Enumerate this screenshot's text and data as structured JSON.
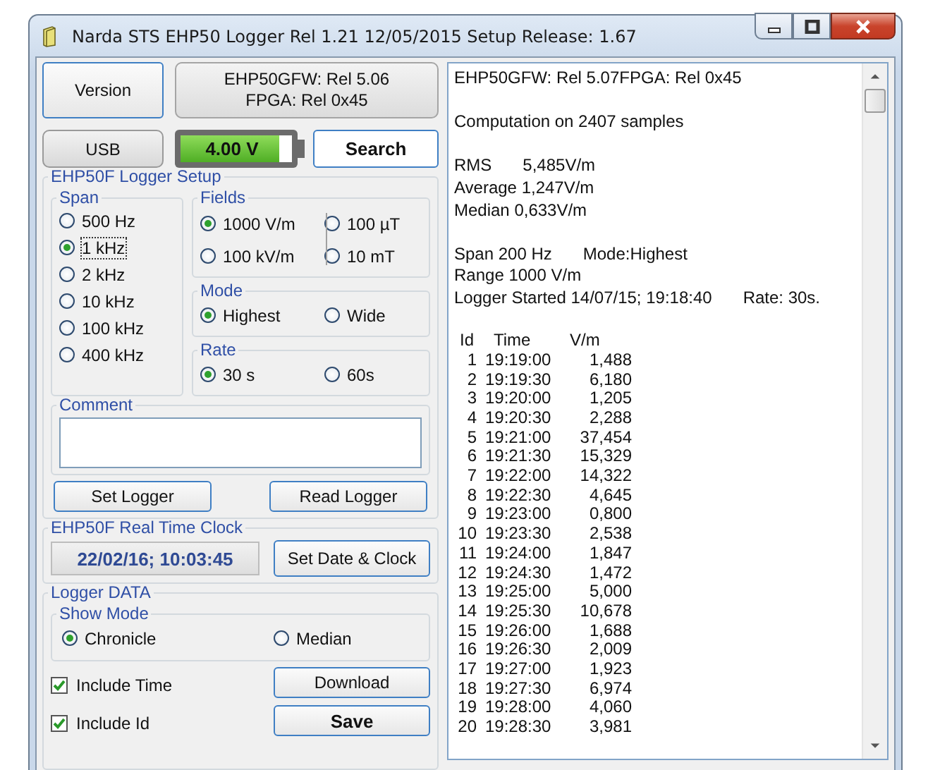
{
  "window": {
    "title": "Narda STS EHP50  Logger Rel 1.21 12/05/2015   Setup Release: 1.67"
  },
  "top": {
    "version_button": "Version",
    "firmware": [
      "EHP50GFW: Rel 5.06",
      "FPGA: Rel 0x45"
    ],
    "usb": "USB",
    "battery": {
      "reading": "4.00 V",
      "level": 0.88
    },
    "search_button": "Search"
  },
  "logger_setup": {
    "title": "EHP50F Logger Setup",
    "span": {
      "title": "Span",
      "options": [
        {
          "label": "500 Hz",
          "selected": false,
          "focused": false
        },
        {
          "label": "1 kHz",
          "selected": true,
          "focused": true
        },
        {
          "label": "2 kHz",
          "selected": false,
          "focused": false
        },
        {
          "label": "10  kHz",
          "selected": false,
          "focused": false
        },
        {
          "label": "100 kHz",
          "selected": false,
          "focused": false
        },
        {
          "label": "400 kHz",
          "selected": false,
          "focused": false
        }
      ]
    },
    "fields": {
      "title": "Fields",
      "options": [
        {
          "label": "1000 V/m",
          "selected": true
        },
        {
          "label": "100 µT",
          "selected": false
        },
        {
          "label": "100 kV/m",
          "selected": false
        },
        {
          "label": "10 mT",
          "selected": false
        }
      ]
    },
    "mode": {
      "title": "Mode",
      "options": [
        {
          "label": "Highest",
          "selected": true
        },
        {
          "label": "Wide",
          "selected": false
        }
      ]
    },
    "rate": {
      "title": "Rate",
      "options": [
        {
          "label": "30 s",
          "selected": true
        },
        {
          "label": "60s",
          "selected": false
        }
      ]
    },
    "comment": {
      "title": "Comment"
    },
    "set_button": "Set Logger",
    "read_button": "Read Logger"
  },
  "clock": {
    "title": "EHP50F Real Time Clock",
    "value": "22/02/16; 10:03:45",
    "button": "Set Date & Clock"
  },
  "logger_data": {
    "title": "Logger DATA",
    "show_mode": {
      "title": "Show Mode",
      "options": [
        {
          "label": "Chronicle",
          "selected": true
        },
        {
          "label": "Median",
          "selected": false
        }
      ]
    },
    "checkboxes": [
      {
        "label": "Include Time",
        "checked": true
      },
      {
        "label": "Include Id",
        "checked": true
      }
    ],
    "download_button": "Download",
    "save_button": "Save"
  },
  "output": {
    "blocks": [
      [
        [
          "EHP50GFW: Rel 5.07FPGA: Rel 0x45"
        ]
      ],
      [
        [
          "Computation on 2407 samples"
        ]
      ],
      [
        [
          "RMS",
          "5,485V/m"
        ],
        [
          "Average 1,247V/m"
        ],
        [
          "Median  0,633V/m"
        ]
      ],
      [
        [
          "Span 200 Hz",
          "Mode:Highest"
        ],
        [
          "Range 1000 V/m"
        ],
        [
          "Logger Started 14/07/15; 19:18:40",
          "Rate: 30s."
        ]
      ]
    ],
    "table": {
      "columns": [
        "Id",
        "Time",
        "V/m"
      ],
      "rows": [
        [
          "1",
          "19:19:00",
          "1,488"
        ],
        [
          "2",
          "19:19:30",
          "6,180"
        ],
        [
          "3",
          "19:20:00",
          "1,205"
        ],
        [
          "4",
          "19:20:30",
          "2,288"
        ],
        [
          "5",
          "19:21:00",
          "37,454"
        ],
        [
          "6",
          "19:21:30",
          "15,329"
        ],
        [
          "7",
          "19:22:00",
          "14,322"
        ],
        [
          "8",
          "19:22:30",
          "4,645"
        ],
        [
          "9",
          "19:23:00",
          "0,800"
        ],
        [
          "10",
          "19:23:30",
          "2,538"
        ],
        [
          "11",
          "19:24:00",
          "1,847"
        ],
        [
          "12",
          "19:24:30",
          "1,472"
        ],
        [
          "13",
          "19:25:00",
          "5,000"
        ],
        [
          "14",
          "19:25:30",
          "10,678"
        ],
        [
          "15",
          "19:26:00",
          "1,688"
        ],
        [
          "16",
          "19:26:30",
          "2,009"
        ],
        [
          "17",
          "19:27:00",
          "1,923"
        ],
        [
          "18",
          "19:27:30",
          "6,974"
        ],
        [
          "19",
          "19:28:00",
          "4,060"
        ],
        [
          "20",
          "19:28:30",
          "3,981"
        ]
      ]
    }
  }
}
